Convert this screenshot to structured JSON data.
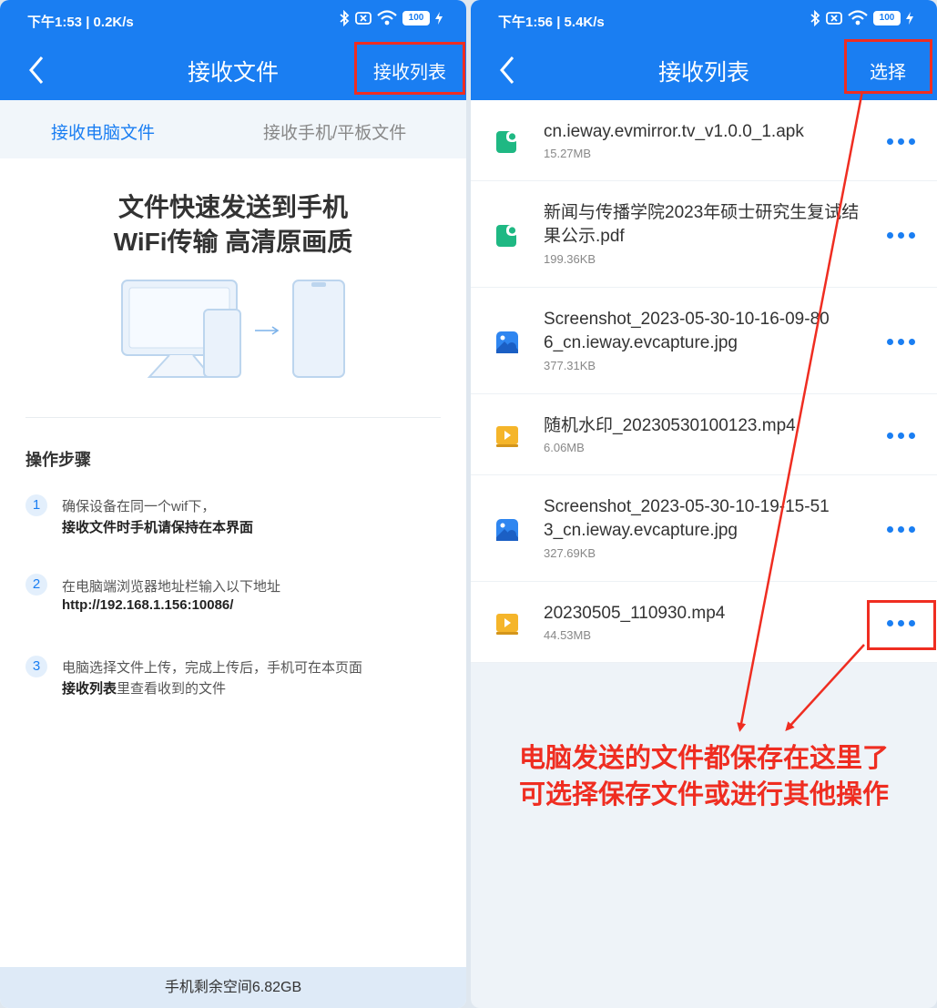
{
  "left": {
    "status": {
      "time": "下午1:53 | 0.2K/s",
      "battery": "100"
    },
    "title": "接收文件",
    "action": "接收列表",
    "tabs": [
      {
        "label": "接收电脑文件",
        "active": true
      },
      {
        "label": "接收手机/平板文件",
        "active": false
      }
    ],
    "headline": [
      "文件快速发送到手机",
      "WiFi传输 高清原画质"
    ],
    "steps_title": "操作步骤",
    "steps": [
      {
        "num": "1",
        "line1": "确保设备在同一个wif下，",
        "line2": "接收文件时手机请保持在本界面"
      },
      {
        "num": "2",
        "line1": "在电脑端浏览器地址栏输入以下地址",
        "line2": "http://192.168.1.156:10086/"
      },
      {
        "num": "3",
        "line1": "电脑选择文件上传，完成上传后，手机可在本页面",
        "line2_bold": "接收列表",
        "line2_rest": "里查看收到的文件"
      }
    ],
    "storage": "手机剩余空间6.82GB"
  },
  "right": {
    "status": {
      "time": "下午1:56 | 5.4K/s",
      "battery": "100"
    },
    "title": "接收列表",
    "action": "选择",
    "files": [
      {
        "name": [
          "cn.ieway.evmirror.tv_v1.0.0_1.apk"
        ],
        "size": "15.27MB",
        "icon": "apk-file-icon",
        "color": "#1fb883"
      },
      {
        "name": [
          "新闻与传播学院2023年硕士研究生复试结",
          "果公示.pdf"
        ],
        "size": "199.36KB",
        "icon": "document-file-icon",
        "color": "#1fb883"
      },
      {
        "name": [
          "Screenshot_2023-05-30-10-16-09-80",
          "6_cn.ieway.evcapture.jpg"
        ],
        "size": "377.31KB",
        "icon": "image-file-icon",
        "color": "#2f86f0"
      },
      {
        "name": [
          "随机水印_20230530100123.mp4"
        ],
        "size": "6.06MB",
        "icon": "video-file-icon",
        "color": "#f5b52a"
      },
      {
        "name": [
          "Screenshot_2023-05-30-10-19-15-51",
          "3_cn.ieway.evcapture.jpg"
        ],
        "size": "327.69KB",
        "icon": "image-file-icon",
        "color": "#2f86f0"
      },
      {
        "name": [
          "20230505_110930.mp4"
        ],
        "size": "44.53MB",
        "icon": "video-file-icon",
        "color": "#f5b52a"
      }
    ],
    "annotation": [
      "电脑发送的文件都保存在这里了",
      "可选择保存文件或进行其他操作"
    ]
  },
  "colors": {
    "primary": "#1a7ef2",
    "annotation_red": "#ef2d21",
    "tab_bg": "#f1f6fa"
  }
}
